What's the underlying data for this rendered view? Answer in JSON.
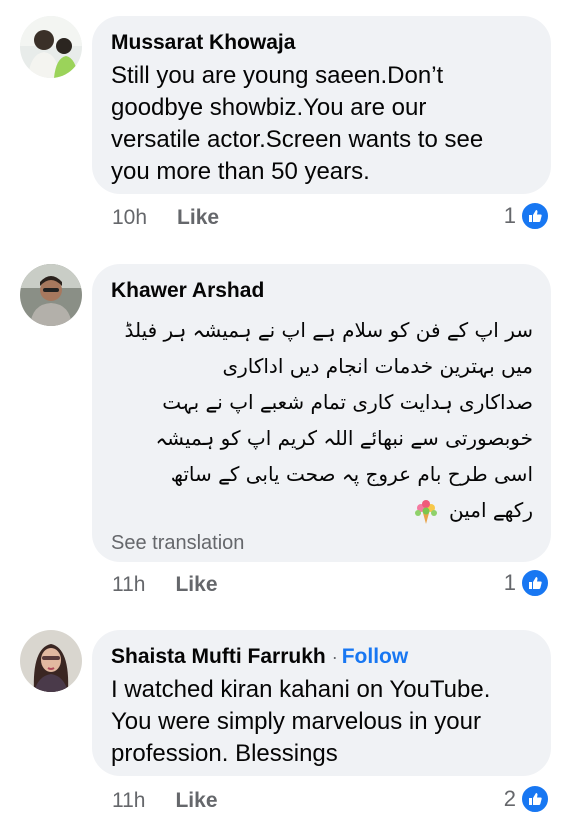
{
  "comments": [
    {
      "author": "Mussarat Khowaja",
      "text": "Still you are young saeen.Don’t\ngoodbye showbiz.You are our\nversatile actor.Screen wants to see\nyou more than 50 years.",
      "time": "10h",
      "like_label": "Like",
      "reaction_count": "1",
      "avatar_icon": "profile-photo"
    },
    {
      "author": "Khawer Arshad",
      "text": "سر اپ کے فن کو سلام ہے اپ نے ہمیشہ ہر فیلڈ\nمیں بہترین خدمات انجام دیں اداکاری\nصداکاری ہدایت کاری تمام شعبے اپ نے بہت\nخوبصورتی سے نبھائے اللہ کریم اپ کو ہمیشہ\nاسی طرح بام عروج پہ صحت یابی کے ساتھ\nرکھے امین",
      "see_translation": "See translation",
      "time": "11h",
      "like_label": "Like",
      "reaction_count": "1",
      "emoji": "bouquet",
      "avatar_icon": "profile-photo"
    },
    {
      "author": "Shaista Mufti Farrukh",
      "follow_label": "Follow",
      "separator": "·",
      "text": "I watched kiran kahani on YouTube.\nYou were simply marvelous in your\nprofession. Blessings",
      "time": "11h",
      "like_label": "Like",
      "reaction_count": "2",
      "avatar_icon": "profile-photo"
    }
  ],
  "colors": {
    "bubble": "#f0f2f5",
    "link": "#1877f2",
    "secondary_text": "#65676b"
  }
}
